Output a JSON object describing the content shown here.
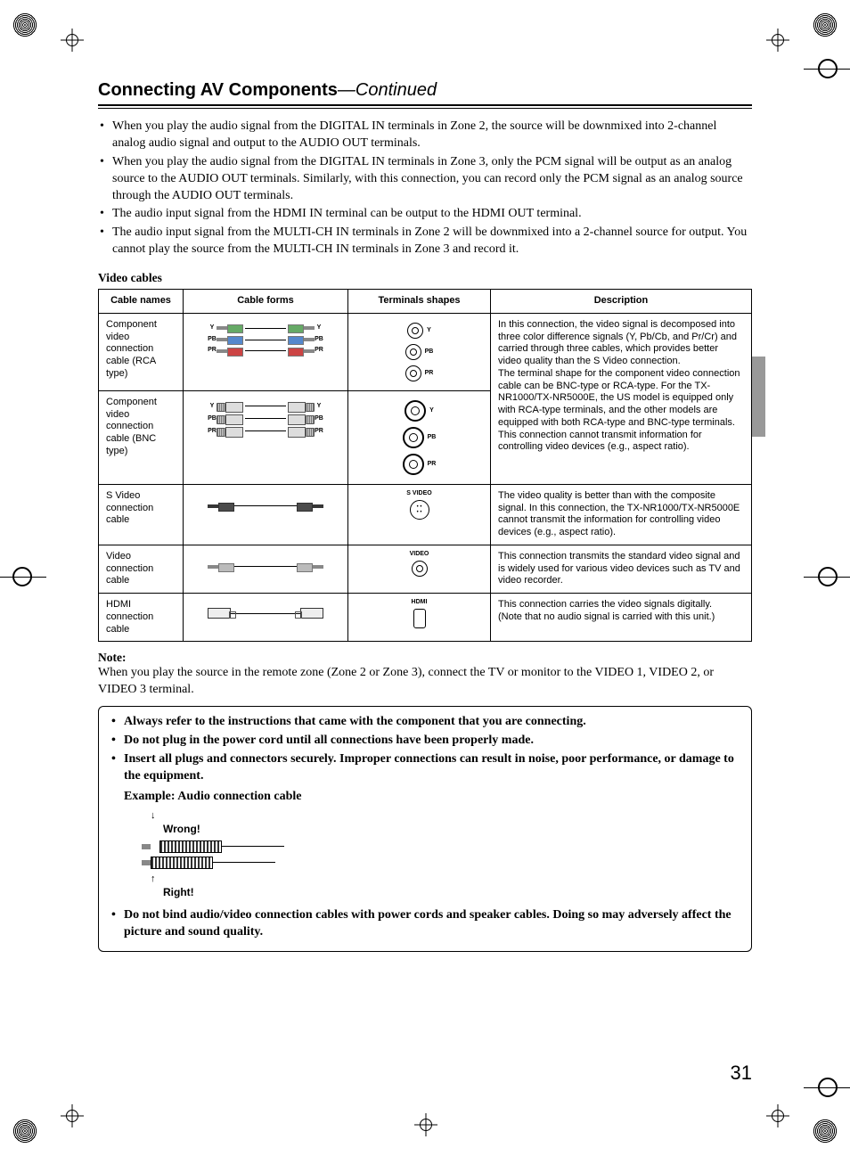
{
  "heading": {
    "title": "Connecting AV Components",
    "continued": "—Continued"
  },
  "intro_bullets": [
    "When you play the audio signal from the DIGITAL IN terminals in Zone 2, the source will be downmixed into 2-channel analog audio signal and output to the AUDIO OUT terminals.",
    "When you play the audio signal from the DIGITAL IN terminals in Zone 3, only the PCM signal will be output as an analog source to the AUDIO OUT terminals. Similarly, with this connection, you can record only the PCM signal as an analog source through the AUDIO OUT terminals.",
    "The audio input signal from the HDMI IN terminal can be output to the HDMI OUT terminal.",
    "The audio input signal from the MULTI-CH IN terminals in Zone 2 will be downmixed into a 2-channel source for output. You cannot play the source from the MULTI-CH IN terminals in Zone 3 and record it."
  ],
  "section_title": "Video cables",
  "table": {
    "headers": [
      "Cable names",
      "Cable forms",
      "Terminals shapes",
      "Description"
    ],
    "rows": [
      {
        "name": "Component video connection cable (RCA type)",
        "terminal_labels": [
          "Y",
          "PB",
          "PR"
        ],
        "desc_shared": "In this connection, the video signal is decomposed into three color difference signals (Y, Pb/Cb, and Pr/Cr) and carried through three cables, which provides better video quality than the S Video connection.\nThe terminal shape for the component video connection cable can be BNC-type or RCA-type. For the TX-NR1000/TX-NR5000E, the US model is equipped only with RCA-type terminals, and the other models are equipped with both RCA-type and BNC-type terminals.\nThis connection cannot transmit information for controlling video devices (e.g., aspect ratio)."
      },
      {
        "name": "Component video connection cable (BNC type)",
        "terminal_labels": [
          "Y",
          "PB",
          "PR"
        ]
      },
      {
        "name": "S Video connection cable",
        "terminal_label": "S VIDEO",
        "desc": "The video quality is better than with the composite signal. In this connection, the TX-NR1000/TX-NR5000E cannot transmit the information for controlling video devices (e.g., aspect ratio)."
      },
      {
        "name": "Video connection cable",
        "terminal_label": "VIDEO",
        "desc": "This connection transmits the standard video signal and is widely used for various video devices such as TV and video recorder."
      },
      {
        "name": "HDMI connection cable",
        "terminal_label": "HDMI",
        "desc": "This connection carries the video signals digitally.\n(Note that no audio signal is carried with this unit.)"
      }
    ]
  },
  "note": {
    "label": "Note:",
    "text": "When you play the source in the remote zone (Zone 2 or Zone 3), connect the TV or monitor to the VIDEO 1, VIDEO 2, or VIDEO 3 terminal."
  },
  "advice": {
    "bullets_top": [
      "Always refer to the instructions that came with the component that you are connecting.",
      "Do not plug in the power cord until all connections have been properly made.",
      "Insert all plugs and connectors securely. Improper connections can result in noise, poor performance, or damage to the equipment."
    ],
    "example_label": "Example: Audio connection cable",
    "wrong_label": "Wrong!",
    "right_label": "Right!",
    "bullets_bottom": [
      "Do not bind audio/video connection cables with power cords and speaker cables. Doing so may adversely affect the picture and sound quality."
    ]
  },
  "page_number": "31"
}
